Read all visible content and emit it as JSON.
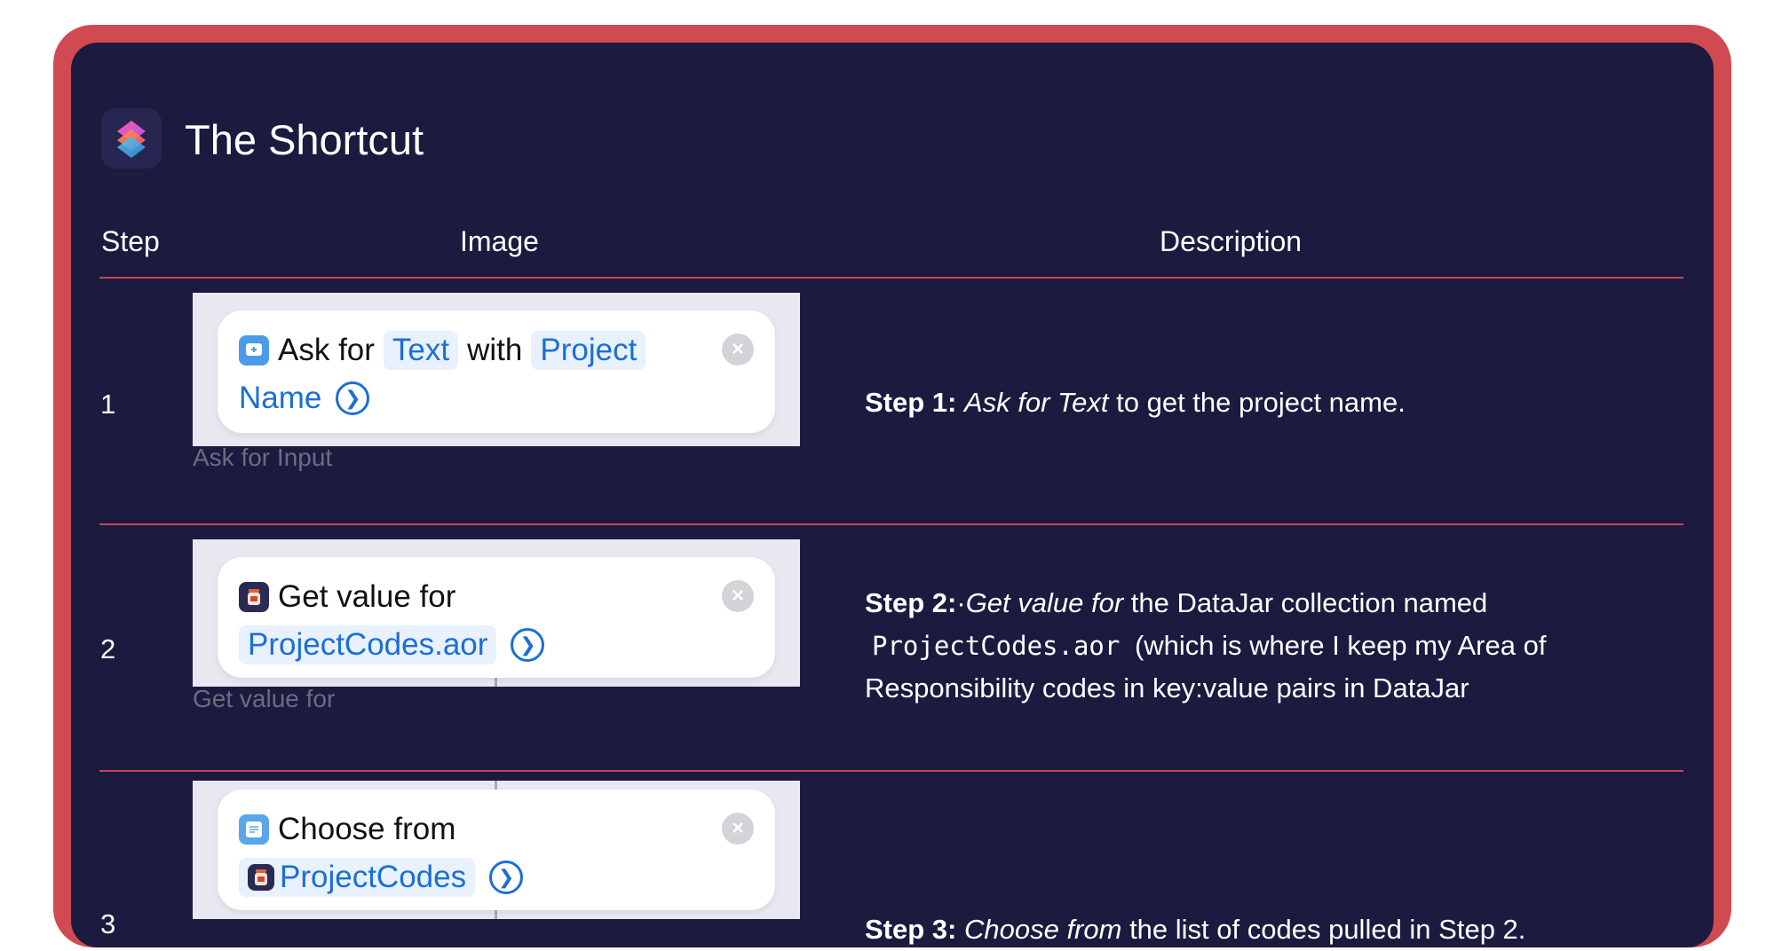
{
  "header": {
    "title": "The Shortcut",
    "icon": "shortcuts-app-icon"
  },
  "table": {
    "columns": [
      "Step",
      "Image",
      "Description"
    ],
    "rows": [
      {
        "step": "1",
        "card": {
          "icon": "ask-for-input-icon",
          "line1": {
            "w1": "Ask for",
            "chip1": "Text",
            "w2": "with",
            "chip2": "Project"
          },
          "line2": {
            "chip": "Name"
          }
        },
        "caption": "Ask for Input",
        "desc": {
          "label": "Step 1:",
          "em": "Ask for Text",
          "rest": " to get the project name."
        }
      },
      {
        "step": "2",
        "card": {
          "icon": "datajar-icon",
          "line1": {
            "w1": "Get value for"
          },
          "line2": {
            "chip": "ProjectCodes.aor"
          }
        },
        "caption": "Get value for",
        "desc": {
          "label": "Step 2:",
          "bullet": "·",
          "em": "Get value for",
          "text1": " the DataJar collection named ",
          "code": "ProjectCodes.aor",
          "text2": " (which is where I keep my Area of Responsibility codes in key:value pairs in DataJar"
        }
      },
      {
        "step": "3",
        "card": {
          "icon": "choose-from-list-icon",
          "line1": {
            "w1": "Choose from"
          },
          "line2": {
            "chip": "ProjectCodes"
          }
        },
        "caption": "",
        "desc": {
          "label": "Step 3:",
          "em": "Choose from",
          "rest": " the list of codes pulled in Step 2."
        }
      }
    ]
  },
  "colors": {
    "frame": "#d14a52",
    "panel": "#1b1b40",
    "accent_blue": "#1a6fd6"
  }
}
